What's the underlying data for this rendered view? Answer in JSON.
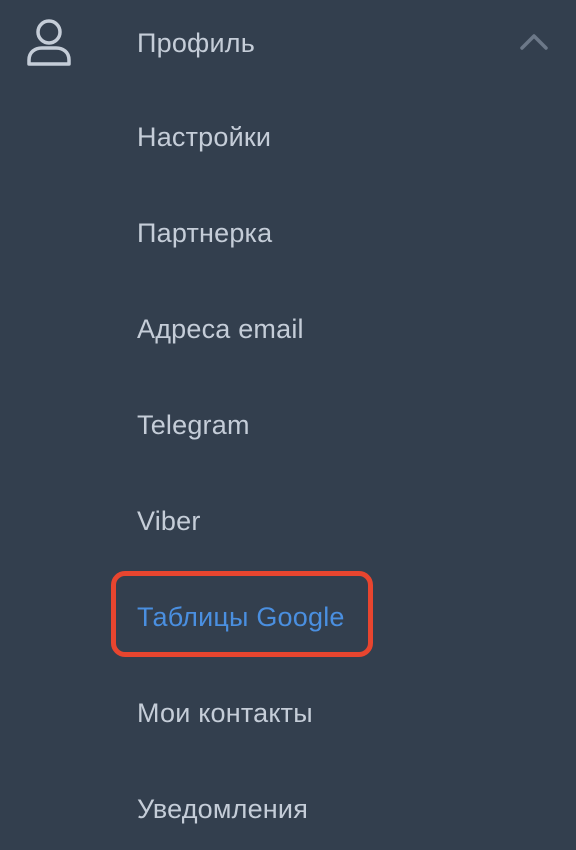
{
  "profile": {
    "label": "Профиль",
    "icon": "user-icon",
    "expanded_icon": "chevron-up-icon"
  },
  "items": [
    {
      "label": "Настройки",
      "active": false
    },
    {
      "label": "Партнерка",
      "active": false
    },
    {
      "label": "Адреса email",
      "active": false
    },
    {
      "label": "Telegram",
      "active": false
    },
    {
      "label": "Viber",
      "active": false
    },
    {
      "label": "Таблицы Google",
      "active": true
    },
    {
      "label": "Мои контакты",
      "active": false
    },
    {
      "label": "Уведомления",
      "active": false
    }
  ],
  "colors": {
    "background": "#333f4e",
    "text": "#c5cdd8",
    "active_text": "#4a8fe0",
    "highlight_border": "#e8452f"
  }
}
